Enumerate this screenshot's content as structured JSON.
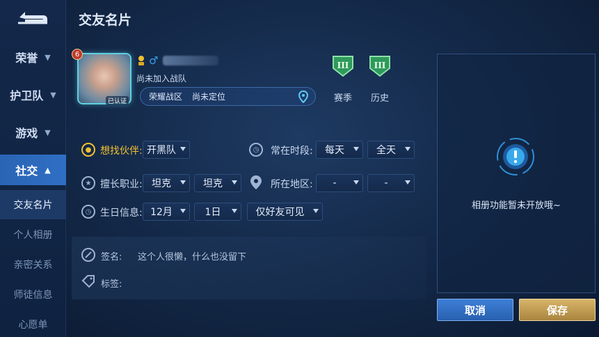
{
  "sidebar": {
    "categories": [
      {
        "label": "荣誉"
      },
      {
        "label": "护卫队"
      },
      {
        "label": "游戏"
      },
      {
        "label": "社交"
      }
    ],
    "sub_items": [
      {
        "label": "交友名片"
      },
      {
        "label": "个人相册"
      },
      {
        "label": "亲密关系"
      },
      {
        "label": "师徒信息"
      },
      {
        "label": "心愿单"
      }
    ]
  },
  "header": {
    "title": "交友名片"
  },
  "profile": {
    "level_badge": "6",
    "rank_tag": "已认证",
    "team_status": "尚未加入战队",
    "zone": "荣耀战区",
    "location": "尚未定位",
    "season_label": "赛季",
    "history_label": "历史",
    "medal_numeral": "III"
  },
  "form": {
    "partner_label": "想找伙伴:",
    "partner_value": "开黑队",
    "time_label": "常在时段:",
    "time_day": "每天",
    "time_range": "全天",
    "role_label": "擅长职业:",
    "role_1": "坦克",
    "role_2": "坦克",
    "region_label": "所在地区:",
    "region_1": "-",
    "region_2": "-",
    "birthday_label": "生日信息:",
    "birth_month": "12月",
    "birth_day": "1日",
    "birth_visibility": "仅好友可见",
    "signature_label": "签名:",
    "signature_value": "这个人很懒，什么也没留下",
    "tags_label": "标签:"
  },
  "album": {
    "message": "相册功能暂未开放哦~"
  },
  "buttons": {
    "cancel": "取消",
    "save": "保存"
  },
  "colors": {
    "accent_blue": "#2f6fc4",
    "gold": "#f0c030",
    "medal_green": "#2e9a5c",
    "save_gold": "#c9a55c"
  }
}
